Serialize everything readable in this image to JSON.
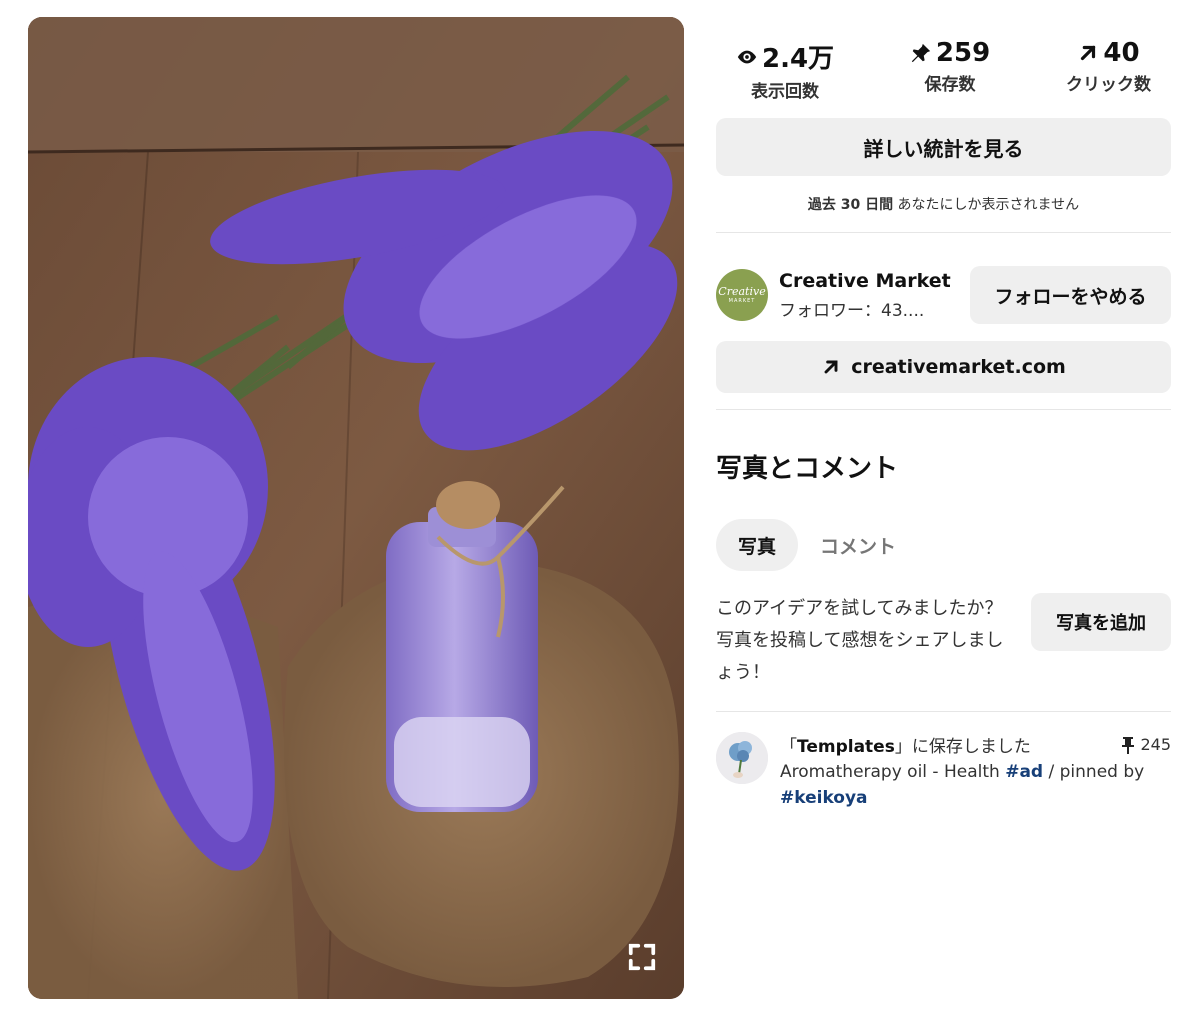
{
  "pin_image": {
    "description_icon": "lavender-oil-photo",
    "expand_icon": "expand-icon"
  },
  "stats": [
    {
      "icon": "eye-icon",
      "value": "2.4万",
      "label": "表示回数"
    },
    {
      "icon": "pin-icon",
      "value": "259",
      "label": "保存数"
    },
    {
      "icon": "arrow-up-right-icon",
      "value": "40",
      "label": "クリック数"
    }
  ],
  "analytics_button": "詳しい統計を見る",
  "privacy": {
    "period": "過去 30 日間",
    "note": "あなたにしか表示されません"
  },
  "creator": {
    "name": "Creative Market",
    "followers": "フォロワー：43....",
    "logo_line1": "Creative",
    "logo_line2": "MARKET",
    "unfollow_button": "フォローをやめる",
    "brand_color": "#8aa050"
  },
  "link": {
    "icon": "arrow-up-right-icon",
    "label": "creativemarket.com"
  },
  "photos_section": {
    "title": "写真とコメント",
    "tabs": [
      "写真",
      "コメント"
    ],
    "try_text": "このアイデアを試してみましたか？写真を投稿して感想をシェアしましょう！",
    "add_photo_button": "写真を追加"
  },
  "saved": {
    "prefix": "「",
    "board": "Templates",
    "suffix": "」に保存しました",
    "repin_count": "245",
    "desc_prefix": "Aromatherapy oil - Health ",
    "tag1": "#ad",
    "desc_middle": " / pinned by ",
    "tag2": "#keikoya"
  },
  "colors": {
    "button_gray": "#efefef",
    "hashtag": "#173f78",
    "text": "#111111"
  }
}
